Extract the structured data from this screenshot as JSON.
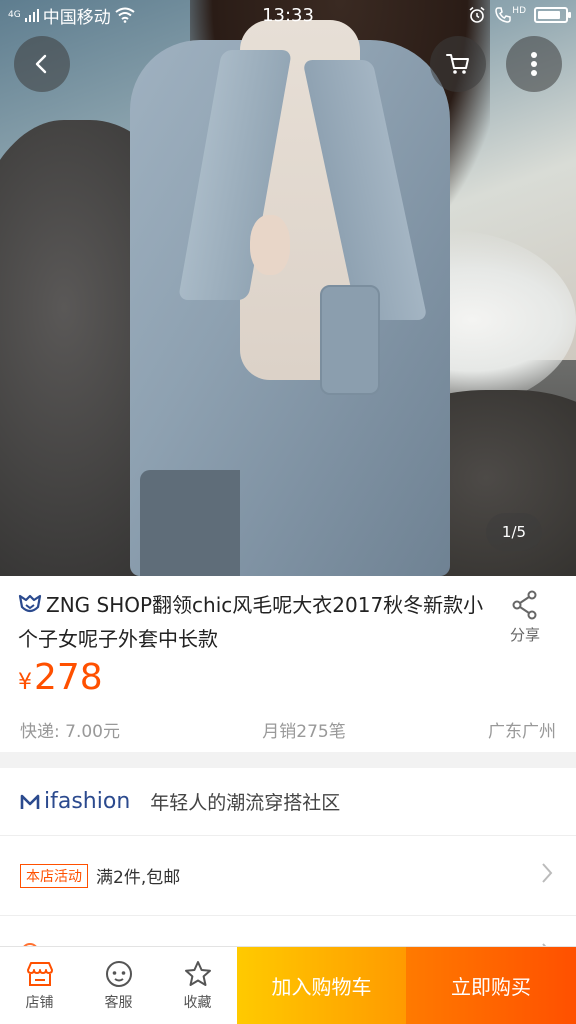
{
  "status_bar": {
    "network": "4G",
    "carrier": "中国移动",
    "time": "13:33",
    "hd_label": "HD",
    "battery_level": 0.85
  },
  "gallery": {
    "counter": "1/5"
  },
  "product": {
    "title": "ZNG SHOP翻领chic风毛呢大衣2017秋冬新款小个子女呢子外套中长款",
    "share_label": "分享",
    "currency": "¥",
    "price": "278",
    "shipping": "快递: 7.00元",
    "monthly_sales": "月销275笔",
    "location": "广东广州"
  },
  "ifashion": {
    "logo_text": "ifashion",
    "slogan": "年轻人的潮流穿搭社区"
  },
  "promo": {
    "tag": "本店活动",
    "text": "满2件,包邮"
  },
  "bottom_bar": {
    "shop_label": "店铺",
    "service_label": "客服",
    "favorite_label": "收藏",
    "add_to_cart": "加入购物车",
    "buy_now": "立即购买"
  },
  "colors": {
    "accent": "#ff5000",
    "cart_button": "#ffb400",
    "brand_blue": "#2b4a8e"
  }
}
